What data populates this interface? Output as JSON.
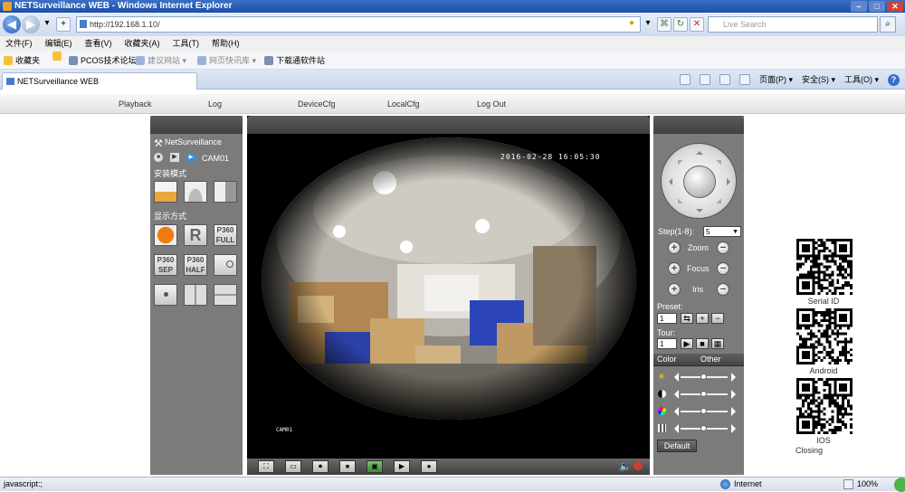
{
  "window": {
    "title": "NETSurveillance WEB - Windows Internet Explorer"
  },
  "browser": {
    "address": "http://192.168.1.10/",
    "search_placeholder": "Live Search",
    "menu": [
      "文件(F)",
      "编辑(E)",
      "查看(V)",
      "收藏夹(A)",
      "工具(T)",
      "帮助(H)"
    ],
    "favorites": [
      {
        "label": "收藏夹"
      },
      {
        "label": "PCOS技术论坛"
      },
      {
        "label": "建议网站 ▾"
      },
      {
        "label": "网页快讯库 ▾"
      },
      {
        "label": "下载通软件站"
      }
    ],
    "tab_label": "NETSurveillance WEB",
    "commands": {
      "page": "页面(P) ▾",
      "safety": "安全(S) ▾",
      "tools": "工具(O) ▾",
      "help": "?"
    },
    "status_left": "javascript:;",
    "status_zone": "Internet",
    "zoom": "100%"
  },
  "nav": {
    "items": [
      "Playback",
      "Log",
      "DeviceCfg",
      "LocalCfg",
      "Log Out"
    ]
  },
  "left_panel": {
    "brand": "NetSurveillance",
    "channel": "CAM01",
    "install_mode_label": "安装模式",
    "display_mode_label": "显示方式",
    "tiles_row2": [
      {
        "line1": "",
        "line2": ""
      },
      {
        "line1": "R",
        "line2": ""
      },
      {
        "line1": "P360",
        "line2": "FULL"
      }
    ],
    "tiles_row3": [
      {
        "line1": "P360",
        "line2": "SEP"
      },
      {
        "line1": "P360",
        "line2": "HALF"
      }
    ]
  },
  "video": {
    "osd_time": "2016-02-28 16:05:30",
    "osd_channel": "CAM01"
  },
  "ptz": {
    "step_label": "Step(1-8):",
    "step_value": "5",
    "zoom_label": "Zoom",
    "focus_label": "Focus",
    "iris_label": "Iris",
    "preset_label": "Preset:",
    "preset_value": "1",
    "tour_label": "Tour:",
    "tour_value": "1",
    "tab_color": "Color",
    "tab_other": "Other",
    "default_label": "Default",
    "sliders": [
      0.5,
      0.5,
      0.5,
      0.5
    ]
  },
  "qr_codes": {
    "serial_caption": "Serial ID",
    "android_caption": "Android",
    "ios_caption": "IOS",
    "closing": "Closing"
  }
}
